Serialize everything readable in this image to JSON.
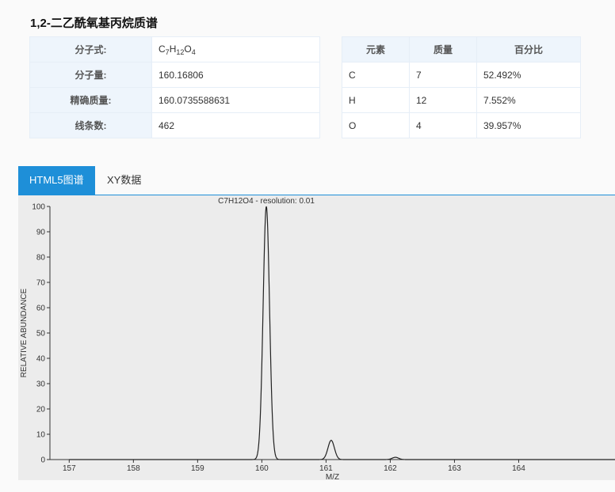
{
  "page": {
    "title": "1,2-二乙酰氧基丙烷质谱"
  },
  "info_table": {
    "rows": [
      {
        "label": "分子式:",
        "value": "C7H12O4"
      },
      {
        "label": "分子量:",
        "value": "160.16806"
      },
      {
        "label": "精确质量:",
        "value": "160.0735588631"
      },
      {
        "label": "线条数:",
        "value": "462"
      }
    ]
  },
  "element_table": {
    "headers": [
      "元素",
      "质量",
      "百分比"
    ],
    "rows": [
      [
        "C",
        "7",
        "52.492%"
      ],
      [
        "H",
        "12",
        "7.552%"
      ],
      [
        "O",
        "4",
        "39.957%"
      ]
    ]
  },
  "tabs": [
    {
      "label": "HTML5图谱",
      "active": true
    },
    {
      "label": "XY数据",
      "active": false
    }
  ],
  "colors": {
    "accent": "#1e8fd8",
    "plot_bg": "#ececec",
    "line": "#222222"
  },
  "chart_data": {
    "type": "line",
    "title": "C7H12O4 - resolution: 0.01",
    "xlabel": "M/Z",
    "ylabel": "RELATIVE ABUNDANCE",
    "xlim": [
      156.7,
      165.5
    ],
    "ylim": [
      0,
      100
    ],
    "xticks": [
      157,
      158,
      159,
      160,
      161,
      162,
      163,
      164
    ],
    "yticks": [
      0,
      10,
      20,
      30,
      40,
      50,
      60,
      70,
      80,
      90,
      100
    ],
    "peaks": [
      {
        "x": 160.07,
        "y": 100
      },
      {
        "x": 161.08,
        "y": 7.6
      },
      {
        "x": 162.08,
        "y": 0.9
      }
    ],
    "grid": false,
    "legend": "none"
  }
}
